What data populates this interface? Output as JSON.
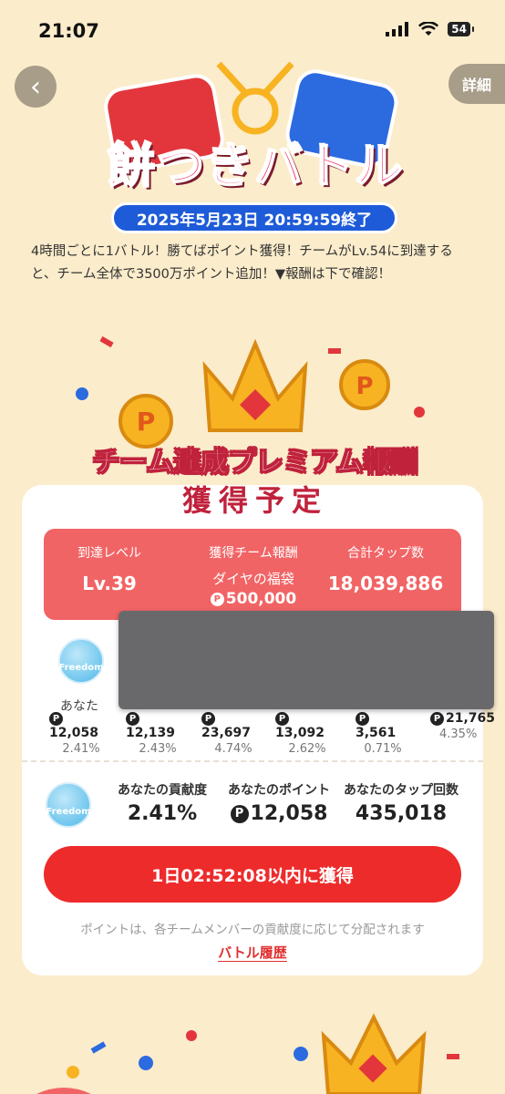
{
  "status": {
    "time": "21:07",
    "battery": "54"
  },
  "nav": {
    "back_label": "‹",
    "detail_label": "詳細"
  },
  "banner": {
    "title": "餅つきバトル",
    "date": "2025年5月23日 20:59:59終了"
  },
  "description": "4時間ごとに1バトル！勝てばポイント獲得！チームがLv.54に到達すると、チーム全体で3500万ポイント追加！▼報酬は下で確認！",
  "premium": {
    "title": "チーム達成プレミアム報酬",
    "subtitle": "獲得予定"
  },
  "stats": {
    "level_label": "到達レベル",
    "level_value": "Lv.39",
    "reward_label": "獲得チーム報酬",
    "reward_name": "ダイヤの福袋",
    "reward_points": "500,000",
    "taps_label": "合計タップ数",
    "taps_value": "18,039,886"
  },
  "members": [
    {
      "name": "あなた",
      "points": "12,058",
      "percent": "2.41%"
    },
    {
      "name": "",
      "points": "12,139",
      "percent": "2.43%"
    },
    {
      "name": "",
      "points": "23,697",
      "percent": "4.74%"
    },
    {
      "name": "",
      "points": "13,092",
      "percent": "2.62%"
    },
    {
      "name": "",
      "points": "3,561",
      "percent": "0.71%"
    },
    {
      "name": "",
      "points": "21,765",
      "percent": "4.35%"
    }
  ],
  "avatar_label": "Freedom",
  "point_glyph": "P",
  "summary": {
    "contrib_label": "あなたの貢献度",
    "contrib_value": "2.41%",
    "points_label": "あなたのポイント",
    "points_value": "12,058",
    "taps_label": "あなたのタップ回数",
    "taps_value": "435,018"
  },
  "cta": "1日02:52:08以内に獲得",
  "note": "ポイントは、各チームメンバーの貢献度に応じて分配されます",
  "history_link": "バトル履歴",
  "colors": {
    "background": "#fbeccb",
    "accent_red": "#ee2b2b",
    "stats_box": "#f16465",
    "date_pill": "#1e5bd8"
  }
}
